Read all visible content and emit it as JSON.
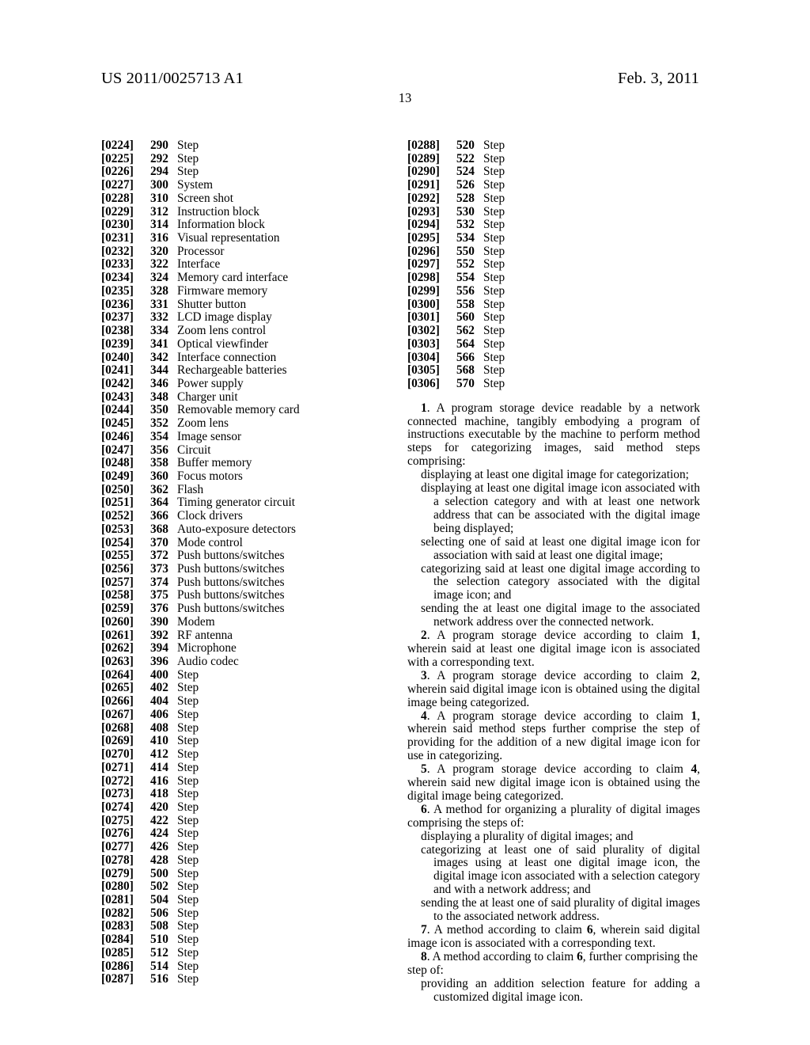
{
  "header": {
    "publication_number": "US 2011/0025713 A1",
    "publication_date": "Feb. 3, 2011",
    "page_number": "13"
  },
  "left_column": {
    "reference_items": [
      {
        "paragraph": "[0224]",
        "numeral": "290",
        "label": "Step"
      },
      {
        "paragraph": "[0225]",
        "numeral": "292",
        "label": "Step"
      },
      {
        "paragraph": "[0226]",
        "numeral": "294",
        "label": "Step"
      },
      {
        "paragraph": "[0227]",
        "numeral": "300",
        "label": "System"
      },
      {
        "paragraph": "[0228]",
        "numeral": "310",
        "label": "Screen shot"
      },
      {
        "paragraph": "[0229]",
        "numeral": "312",
        "label": "Instruction block"
      },
      {
        "paragraph": "[0230]",
        "numeral": "314",
        "label": "Information block"
      },
      {
        "paragraph": "[0231]",
        "numeral": "316",
        "label": "Visual representation"
      },
      {
        "paragraph": "[0232]",
        "numeral": "320",
        "label": "Processor"
      },
      {
        "paragraph": "[0233]",
        "numeral": "322",
        "label": "Interface"
      },
      {
        "paragraph": "[0234]",
        "numeral": "324",
        "label": "Memory card interface"
      },
      {
        "paragraph": "[0235]",
        "numeral": "328",
        "label": "Firmware memory"
      },
      {
        "paragraph": "[0236]",
        "numeral": "331",
        "label": "Shutter button"
      },
      {
        "paragraph": "[0237]",
        "numeral": "332",
        "label": "LCD image display"
      },
      {
        "paragraph": "[0238]",
        "numeral": "334",
        "label": "Zoom lens control"
      },
      {
        "paragraph": "[0239]",
        "numeral": "341",
        "label": "Optical viewfinder"
      },
      {
        "paragraph": "[0240]",
        "numeral": "342",
        "label": "Interface connection"
      },
      {
        "paragraph": "[0241]",
        "numeral": "344",
        "label": "Rechargeable batteries"
      },
      {
        "paragraph": "[0242]",
        "numeral": "346",
        "label": "Power supply"
      },
      {
        "paragraph": "[0243]",
        "numeral": "348",
        "label": "Charger unit"
      },
      {
        "paragraph": "[0244]",
        "numeral": "350",
        "label": "Removable memory card"
      },
      {
        "paragraph": "[0245]",
        "numeral": "352",
        "label": "Zoom lens"
      },
      {
        "paragraph": "[0246]",
        "numeral": "354",
        "label": "Image sensor"
      },
      {
        "paragraph": "[0247]",
        "numeral": "356",
        "label": "Circuit"
      },
      {
        "paragraph": "[0248]",
        "numeral": "358",
        "label": "Buffer memory"
      },
      {
        "paragraph": "[0249]",
        "numeral": "360",
        "label": "Focus motors"
      },
      {
        "paragraph": "[0250]",
        "numeral": "362",
        "label": "Flash"
      },
      {
        "paragraph": "[0251]",
        "numeral": "364",
        "label": "Timing generator circuit"
      },
      {
        "paragraph": "[0252]",
        "numeral": "366",
        "label": "Clock drivers"
      },
      {
        "paragraph": "[0253]",
        "numeral": "368",
        "label": "Auto-exposure detectors"
      },
      {
        "paragraph": "[0254]",
        "numeral": "370",
        "label": "Mode control"
      },
      {
        "paragraph": "[0255]",
        "numeral": "372",
        "label": "Push buttons/switches"
      },
      {
        "paragraph": "[0256]",
        "numeral": "373",
        "label": "Push buttons/switches"
      },
      {
        "paragraph": "[0257]",
        "numeral": "374",
        "label": "Push buttons/switches"
      },
      {
        "paragraph": "[0258]",
        "numeral": "375",
        "label": "Push buttons/switches"
      },
      {
        "paragraph": "[0259]",
        "numeral": "376",
        "label": "Push buttons/switches"
      },
      {
        "paragraph": "[0260]",
        "numeral": "390",
        "label": "Modem"
      },
      {
        "paragraph": "[0261]",
        "numeral": "392",
        "label": "RF antenna"
      },
      {
        "paragraph": "[0262]",
        "numeral": "394",
        "label": "Microphone"
      },
      {
        "paragraph": "[0263]",
        "numeral": "396",
        "label": "Audio codec"
      },
      {
        "paragraph": "[0264]",
        "numeral": "400",
        "label": "Step"
      },
      {
        "paragraph": "[0265]",
        "numeral": "402",
        "label": "Step"
      },
      {
        "paragraph": "[0266]",
        "numeral": "404",
        "label": "Step"
      },
      {
        "paragraph": "[0267]",
        "numeral": "406",
        "label": "Step"
      },
      {
        "paragraph": "[0268]",
        "numeral": "408",
        "label": "Step"
      },
      {
        "paragraph": "[0269]",
        "numeral": "410",
        "label": "Step"
      },
      {
        "paragraph": "[0270]",
        "numeral": "412",
        "label": "Step"
      },
      {
        "paragraph": "[0271]",
        "numeral": "414",
        "label": "Step"
      },
      {
        "paragraph": "[0272]",
        "numeral": "416",
        "label": "Step"
      },
      {
        "paragraph": "[0273]",
        "numeral": "418",
        "label": "Step"
      },
      {
        "paragraph": "[0274]",
        "numeral": "420",
        "label": "Step"
      },
      {
        "paragraph": "[0275]",
        "numeral": "422",
        "label": "Step"
      },
      {
        "paragraph": "[0276]",
        "numeral": "424",
        "label": "Step"
      },
      {
        "paragraph": "[0277]",
        "numeral": "426",
        "label": "Step"
      },
      {
        "paragraph": "[0278]",
        "numeral": "428",
        "label": "Step"
      },
      {
        "paragraph": "[0279]",
        "numeral": "500",
        "label": "Step"
      },
      {
        "paragraph": "[0280]",
        "numeral": "502",
        "label": "Step"
      },
      {
        "paragraph": "[0281]",
        "numeral": "504",
        "label": "Step"
      },
      {
        "paragraph": "[0282]",
        "numeral": "506",
        "label": "Step"
      },
      {
        "paragraph": "[0283]",
        "numeral": "508",
        "label": "Step"
      },
      {
        "paragraph": "[0284]",
        "numeral": "510",
        "label": "Step"
      },
      {
        "paragraph": "[0285]",
        "numeral": "512",
        "label": "Step"
      },
      {
        "paragraph": "[0286]",
        "numeral": "514",
        "label": "Step"
      },
      {
        "paragraph": "[0287]",
        "numeral": "516",
        "label": "Step"
      }
    ]
  },
  "right_column": {
    "reference_items": [
      {
        "paragraph": "[0288]",
        "numeral": "520",
        "label": "Step"
      },
      {
        "paragraph": "[0289]",
        "numeral": "522",
        "label": "Step"
      },
      {
        "paragraph": "[0290]",
        "numeral": "524",
        "label": "Step"
      },
      {
        "paragraph": "[0291]",
        "numeral": "526",
        "label": "Step"
      },
      {
        "paragraph": "[0292]",
        "numeral": "528",
        "label": "Step"
      },
      {
        "paragraph": "[0293]",
        "numeral": "530",
        "label": "Step"
      },
      {
        "paragraph": "[0294]",
        "numeral": "532",
        "label": "Step"
      },
      {
        "paragraph": "[0295]",
        "numeral": "534",
        "label": "Step"
      },
      {
        "paragraph": "[0296]",
        "numeral": "550",
        "label": "Step"
      },
      {
        "paragraph": "[0297]",
        "numeral": "552",
        "label": "Step"
      },
      {
        "paragraph": "[0298]",
        "numeral": "554",
        "label": "Step"
      },
      {
        "paragraph": "[0299]",
        "numeral": "556",
        "label": "Step"
      },
      {
        "paragraph": "[0300]",
        "numeral": "558",
        "label": "Step"
      },
      {
        "paragraph": "[0301]",
        "numeral": "560",
        "label": "Step"
      },
      {
        "paragraph": "[0302]",
        "numeral": "562",
        "label": "Step"
      },
      {
        "paragraph": "[0303]",
        "numeral": "564",
        "label": "Step"
      },
      {
        "paragraph": "[0304]",
        "numeral": "566",
        "label": "Step"
      },
      {
        "paragraph": "[0305]",
        "numeral": "568",
        "label": "Step"
      },
      {
        "paragraph": "[0306]",
        "numeral": "570",
        "label": "Step"
      }
    ],
    "claims": {
      "claim1": {
        "number": "1",
        "lead": ". A program storage device readable by a network connected machine, tangibly embodying a program of instructions executable by the machine to perform method steps for categorizing images, said method steps comprising:",
        "steps": [
          "displaying at least one digital image for categorization;",
          "displaying at least one digital image icon associated with a selection category and with at least one network address that can be associated with the digital image being displayed;",
          "selecting one of said at least one digital image icon for association with said at least one digital image;",
          "categorizing said at least one digital image according to the selection category associated with the digital image icon; and",
          "sending the at least one digital image to the associated network address over the connected network."
        ]
      },
      "claim2": {
        "number": "2",
        "text_before": ". A program storage device according to claim ",
        "ref": "1",
        "text_after": ", wherein said at least one digital image icon is associated with a corresponding text."
      },
      "claim3": {
        "number": "3",
        "text_before": ". A program storage device according to claim ",
        "ref": "2",
        "text_after": ", wherein said digital image icon is obtained using the digital image being categorized."
      },
      "claim4": {
        "number": "4",
        "text_before": ". A program storage device according to claim ",
        "ref": "1",
        "text_after": ", wherein said method steps further comprise the step of providing for the addition of a new digital image icon for use in categorizing."
      },
      "claim5": {
        "number": "5",
        "text_before": ". A program storage device according to claim ",
        "ref": "4",
        "text_after": ", wherein said new digital image icon is obtained using the digital image being categorized."
      },
      "claim6": {
        "number": "6",
        "lead": ". A method for organizing a plurality of digital images comprising the steps of:",
        "steps": [
          "displaying a plurality of digital images; and",
          "categorizing at least one of said plurality of digital images using at least one digital image icon, the digital image icon associated with a selection category and with a network address; and",
          "sending the at least one of said plurality of digital images to the associated network address."
        ]
      },
      "claim7": {
        "number": "7",
        "text_before": ". A method according to claim ",
        "ref": "6",
        "text_after": ", wherein said digital image icon is associated with a corresponding text."
      },
      "claim8": {
        "number": "8",
        "text_before": ". A method according to claim ",
        "ref": "6",
        "text_after": ", further comprising the step of:",
        "steps": [
          "providing an addition selection feature for adding a customized digital image icon."
        ]
      }
    }
  }
}
